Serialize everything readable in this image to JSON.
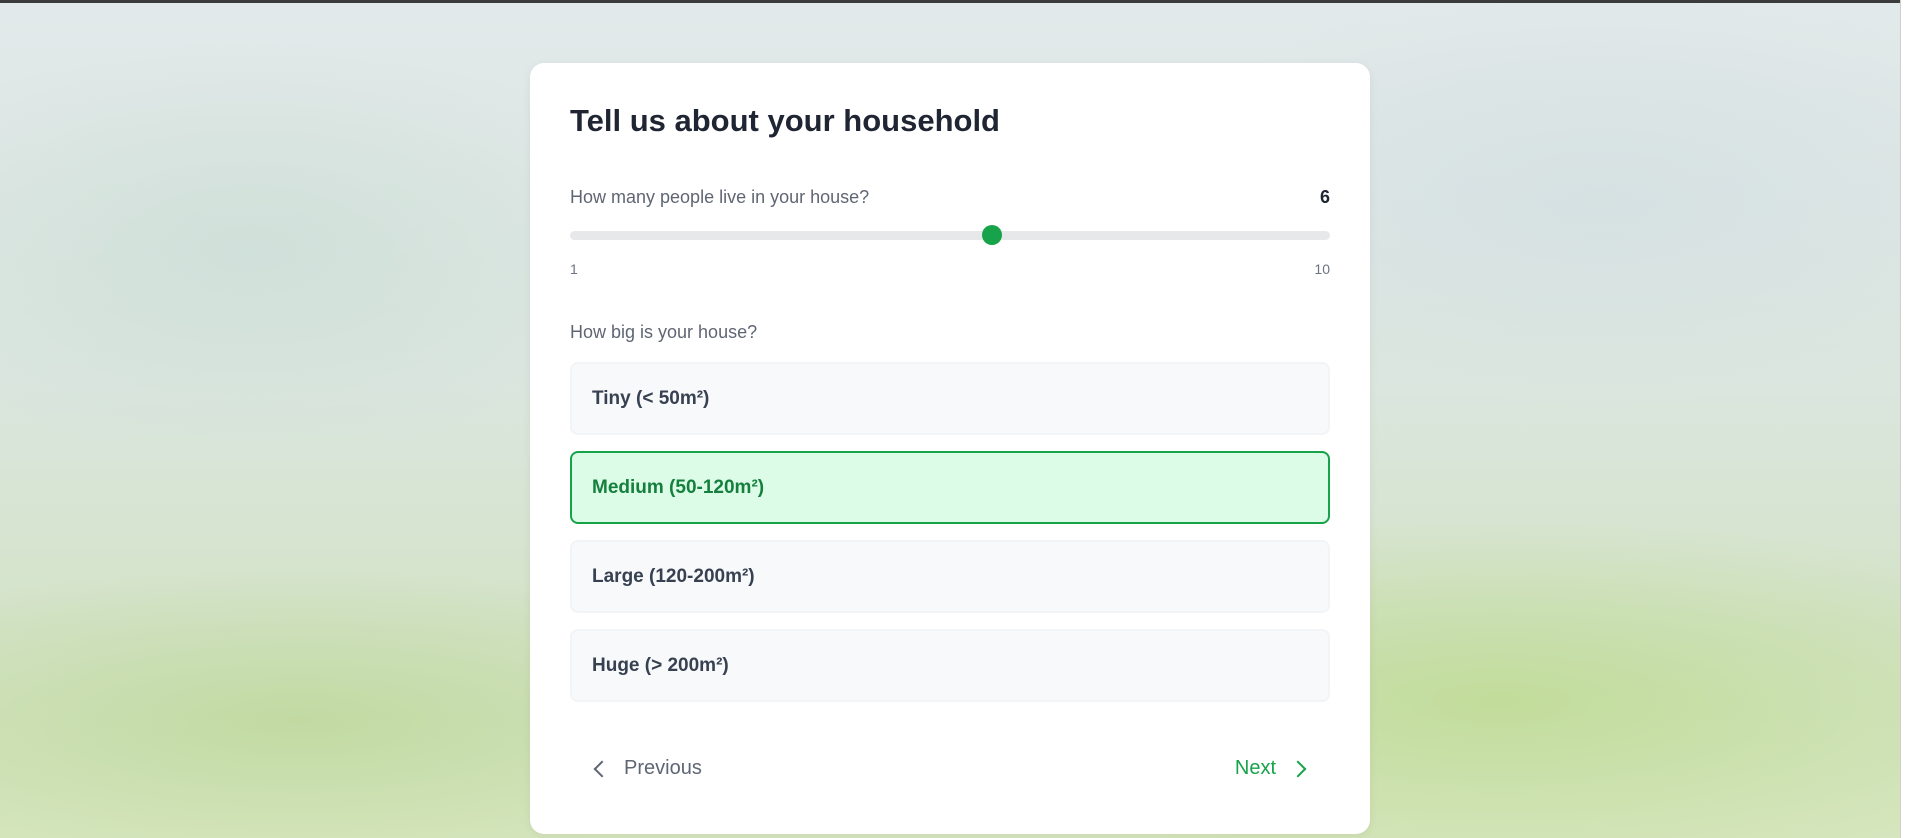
{
  "theme": {
    "accent": "#16a34a",
    "accent_dark": "#15803d",
    "selected_bg": "#dcfce7",
    "option_bg": "#f8f9fa",
    "title_color": "#1f2533",
    "muted_text": "#5f6673"
  },
  "card": {
    "title": "Tell us about your household"
  },
  "people_question": {
    "label": "How many people live in your house?",
    "value": "6",
    "min": "1",
    "max": "10",
    "fraction": 0.555
  },
  "size_question": {
    "label": "How big is your house?",
    "selected_index": 1,
    "options": [
      {
        "label": "Tiny (< 50m²)"
      },
      {
        "label": "Medium (50-120m²)"
      },
      {
        "label": "Large (120-200m²)"
      },
      {
        "label": "Huge (> 200m²)"
      }
    ]
  },
  "navigation": {
    "previous_label": "Previous",
    "previous_icon": "chevron-left-icon",
    "next_label": "Next",
    "next_icon": "chevron-right-icon"
  }
}
